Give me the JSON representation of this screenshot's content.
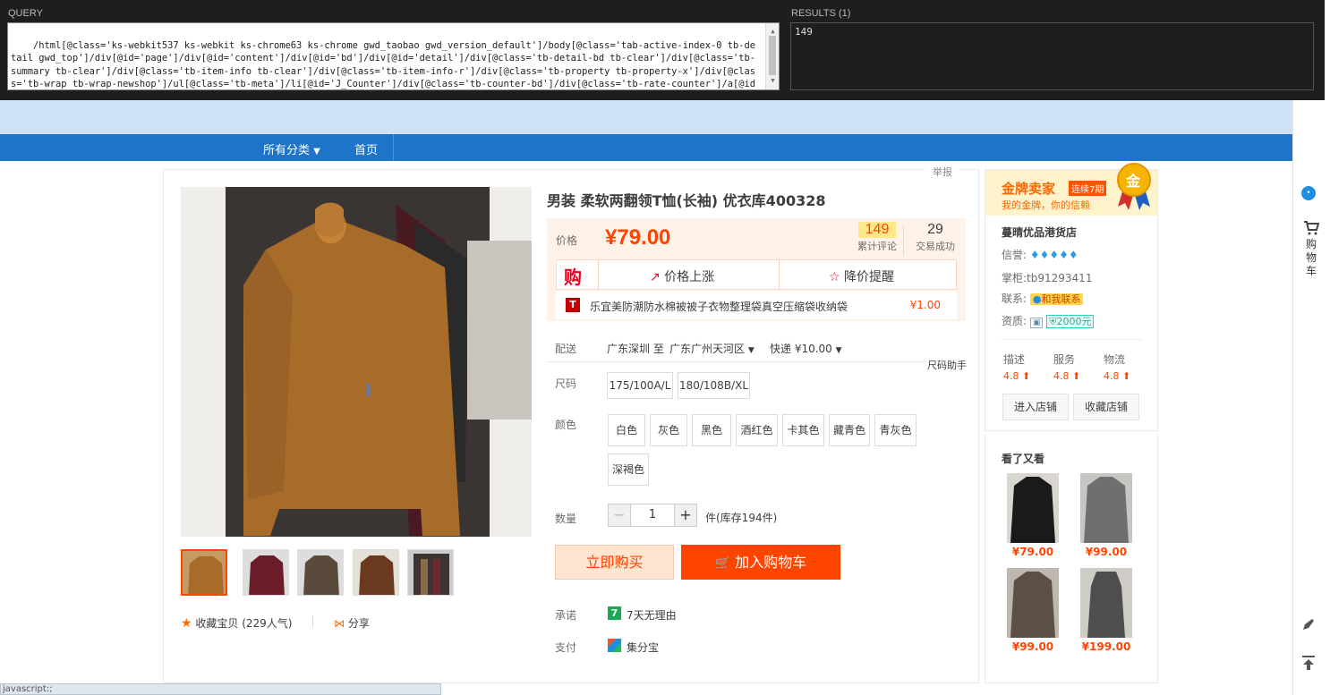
{
  "xpath_helper": {
    "query_label": "QUERY",
    "results_label": "RESULTS (1)",
    "query": "/html[@class='ks-webkit537 ks-webkit ks-chrome63 ks-chrome gwd_taobao gwd_version_default']/body[@class='tab-active-index-0 tb-detail gwd_top']/div[@id='page']/div[@id='content']/div[@id='bd']/div[@id='detail']/div[@class='tb-detail-bd tb-clear']/div[@class='tb-summary tb-clear']/div[@class='tb-item-info tb-clear']/div[@class='tb-item-info-r']/div[@class='tb-property tb-property-x']/div[@class='tb-wrap tb-wrap-newshop']/ul[@class='tb-meta']/li[@id='J_Counter']/div[@class='tb-counter-bd']/div[@class='tb-rate-counter']/a[@id='J_ReviewTabTrigger']/strong[@id='J_RateCounter']",
    "result": "149"
  },
  "nav": {
    "all_categories": "所有分类",
    "home": "首页"
  },
  "report": "举报",
  "product": {
    "title": "男装 柔软两翻领T恤(长袖) 优衣库400328",
    "price_label": "价格",
    "price": "¥79.00",
    "reviews_count": "149",
    "reviews_label": "累计评论",
    "sales_count": "29",
    "sales_label": "交易成功",
    "price_up": "价格上涨",
    "price_alert": "降价提醒",
    "promo_text": "乐宜美防潮防水棉被被子衣物整理袋真空压缩袋收纳袋",
    "promo_price": "¥1.00",
    "delivery_label": "配送",
    "delivery_from": "广东深圳 至",
    "delivery_to": "广东广州天河区",
    "shipping": "快递 ¥10.00",
    "size_helper": "尺码助手",
    "size_label": "尺码",
    "sizes": [
      "175/100A/L",
      "180/108B/XL"
    ],
    "color_label": "颜色",
    "colors": [
      "白色",
      "灰色",
      "黑色",
      "酒红色",
      "卡其色",
      "藏青色",
      "青灰色",
      "深褐色"
    ],
    "qty_label": "数量",
    "qty_value": "1",
    "stock": "件(库存194件)",
    "buy_now": "立即购买",
    "add_cart": "加入购物车",
    "promise_label": "承诺",
    "promise": "7天无理由",
    "pay_label": "支付",
    "pay": "集分宝",
    "favorite": "收藏宝贝 (229人气)",
    "share": "分享"
  },
  "shop": {
    "gold_title": "金牌卖家",
    "gold_badge": "连续7期",
    "gold_sub": "我的金牌，你的信赖",
    "medal": "金",
    "name": "蔓晴优品港货店",
    "credit_label": "信誉:",
    "keeper_label": "掌柜:",
    "keeper": "tb91293411",
    "contact_label": "联系:",
    "contact": "和我联系",
    "qual_label": "资质:",
    "deposit": "2000元",
    "desc_label": "描述",
    "desc_score": "4.8",
    "service_label": "服务",
    "service_score": "4.8",
    "logistics_label": "物流",
    "logistics_score": "4.8",
    "enter_shop": "进入店铺",
    "fav_shop": "收藏店铺"
  },
  "related": {
    "title": "看了又看",
    "items": [
      {
        "price": "¥79.00",
        "color": "#1a1a1a"
      },
      {
        "price": "¥99.00",
        "color": "#6f6f6f"
      },
      {
        "price": "¥99.00",
        "color": "#5b4f46"
      },
      {
        "price": "¥199.00",
        "color": "#4e4e4e"
      }
    ]
  },
  "sidebar": {
    "cart": "购物车"
  },
  "status_bar": "javascript:;"
}
